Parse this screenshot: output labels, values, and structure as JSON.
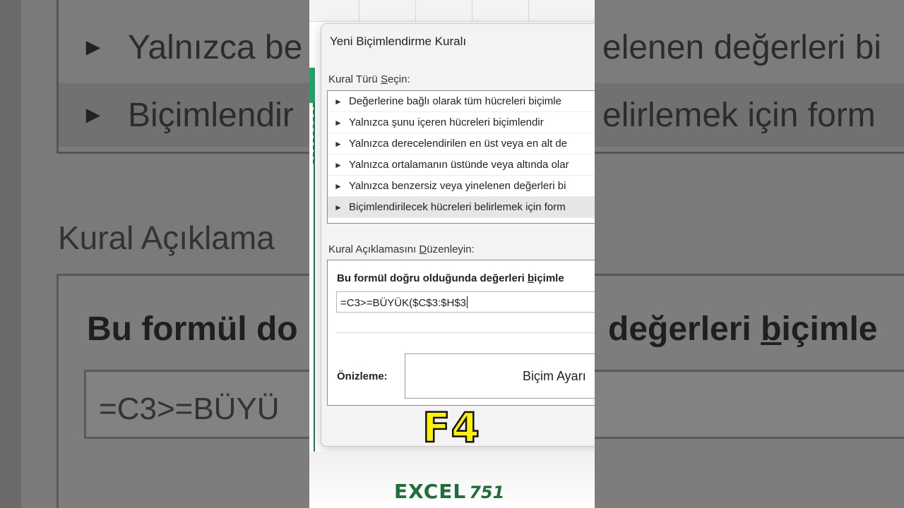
{
  "dialog": {
    "title": "Yeni Biçimlendirme Kuralı",
    "select_rule_type_label": {
      "before": "Kural Türü ",
      "mnemonic": "S",
      "after": "eçin:"
    },
    "rule_types": [
      {
        "label": "Değerlerine bağlı olarak tüm hücreleri biçimle",
        "selected": false
      },
      {
        "label": "Yalnızca şunu içeren hücreleri biçimlendir",
        "selected": false
      },
      {
        "label": "Yalnızca derecelendirilen en üst veya en alt de",
        "selected": false
      },
      {
        "label": "Yalnızca ortalamanın üstünde veya altında olar",
        "selected": false
      },
      {
        "label": "Yalnızca benzersiz veya yinelenen değerleri bi",
        "selected": false
      },
      {
        "label": "Biçimlendirilecek hücreleri belirlemek için form",
        "selected": true
      }
    ],
    "edit_description_label": {
      "before": "Kural Açıklamasını ",
      "mnemonic": "D",
      "after": "üzenleyin:"
    },
    "formula_label": {
      "before": "Bu formül doğru olduğunda değerleri ",
      "mnemonic": "b",
      "after": "içimle"
    },
    "formula_value": "=C3>=BÜYÜK($C$3:$H$3",
    "preview_label": "Önizleme:",
    "preview_text": "Biçim Ayarı"
  },
  "overlay": {
    "key_hint": "F4"
  },
  "brand": {
    "name": "EXCEL",
    "number": "751"
  },
  "background_zoom": {
    "row1": "Yalnızca be",
    "row1_right": "elenen değerleri bi",
    "row2": "Biçimlendir",
    "row2_right": "elirlemek için form",
    "title": "Kural Açıklama",
    "bold_left": "Bu formül do",
    "bold_right_before": " değerleri ",
    "bold_right_mnemonic": "b",
    "bold_right_after": "içimle",
    "formula": "=C3>=BÜYÜ"
  },
  "colors": {
    "accent_green": "#1e7e4b",
    "key_yellow": "#fff200"
  }
}
